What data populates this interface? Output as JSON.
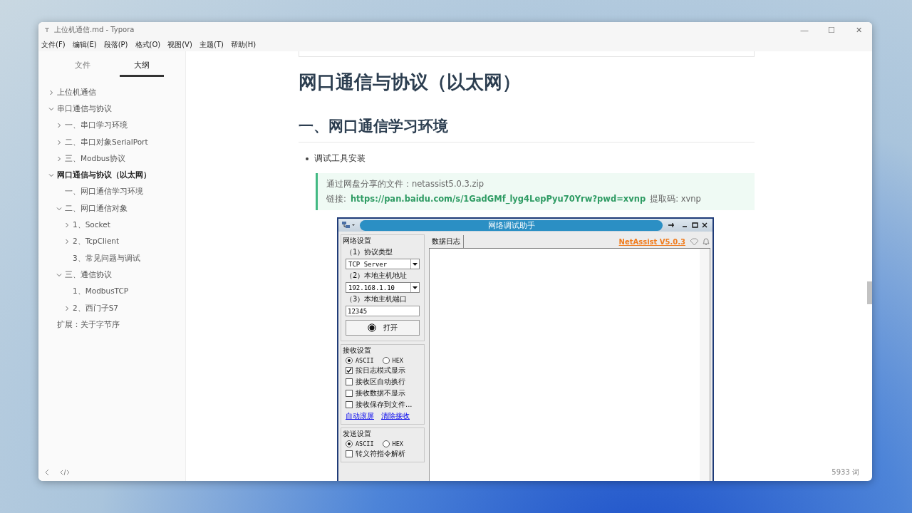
{
  "window": {
    "title": "上位机通信.md - Typora",
    "controls": [
      "—",
      "☐",
      "✕"
    ]
  },
  "menu": [
    "文件(F)",
    "编辑(E)",
    "段落(P)",
    "格式(O)",
    "视图(V)",
    "主题(T)",
    "帮助(H)"
  ],
  "sidebar": {
    "tabs": [
      {
        "label": "文件",
        "selected": false
      },
      {
        "label": "大纲",
        "selected": true
      }
    ],
    "outline": [
      {
        "label": "上位机通信",
        "expanded": false,
        "selected": false
      },
      {
        "label": "串口通信与协议",
        "expanded": true,
        "selected": false,
        "children": [
          {
            "label": "一、串口学习环境",
            "expanded": false,
            "selected": false
          },
          {
            "label": "二、串口对象SerialPort",
            "expanded": false,
            "selected": false
          },
          {
            "label": "三、Modbus协议",
            "expanded": false,
            "selected": false
          }
        ]
      },
      {
        "label": "网口通信与协议（以太网）",
        "expanded": true,
        "selected": true,
        "children": [
          {
            "label": "一、网口通信学习环境",
            "selected": false
          },
          {
            "label": "二、网口通信对象",
            "expanded": true,
            "selected": false,
            "children": [
              {
                "label": "1、Socket",
                "expanded": false,
                "selected": false
              },
              {
                "label": "2、TcpClient",
                "expanded": false,
                "selected": false
              },
              {
                "label": "3、常见问题与调试",
                "selected": false
              }
            ]
          },
          {
            "label": "三、通信协议",
            "expanded": true,
            "selected": false,
            "children": [
              {
                "label": "1、ModbusTCP",
                "selected": false
              },
              {
                "label": "2、西门子S7",
                "expanded": false,
                "selected": false
              }
            ]
          }
        ]
      },
      {
        "label": "扩展：关于字节序",
        "selected": false
      }
    ]
  },
  "document": {
    "h1": "网口通信与协议（以太网）",
    "h2": "一、网口通信学习环境",
    "bullet": "调试工具安装",
    "note": {
      "line1": "通过网盘分享的文件：netassist5.0.3.zip",
      "link_label": "链接:",
      "link": "https://pan.baidu.com/s/1GadGMf_lyg4LepPyu70Yrw?pwd=xvnp",
      "code": "提取码: xvnp"
    }
  },
  "netassist": {
    "title": "网络调试助手",
    "version": "NetAssist V5.0.3",
    "log_tab": "数据日志",
    "network": {
      "title": "网络设置",
      "protocol_label": "（1）协议类型",
      "protocol": "TCP Server",
      "host_label": "（2）本地主机地址",
      "host": "192.168.1.10",
      "port_label": "（3）本地主机端口",
      "port": "12345",
      "open_button": "打开"
    },
    "receive": {
      "title": "接收设置",
      "modes": [
        {
          "label": "ASCII",
          "selected": true
        },
        {
          "label": "HEX",
          "selected": false
        }
      ],
      "options": [
        {
          "label": "按日志模式显示",
          "checked": true
        },
        {
          "label": "接收区自动换行",
          "checked": false
        },
        {
          "label": "接收数据不显示",
          "checked": false
        },
        {
          "label": "接收保存到文件...",
          "checked": false
        }
      ],
      "links": [
        "自动滚屏",
        "清除接收"
      ]
    },
    "send": {
      "title": "发送设置",
      "modes": [
        {
          "label": "ASCII",
          "selected": true
        },
        {
          "label": "HEX",
          "selected": false
        }
      ],
      "options": [
        {
          "label": "转义符指令解析",
          "checked": false
        }
      ]
    }
  },
  "status_bar": {
    "word_count": "5933 词"
  }
}
